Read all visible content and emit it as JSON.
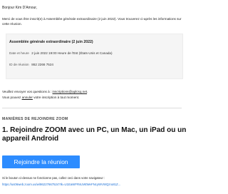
{
  "email": {
    "greeting": "Bonjour Kim D'Amour,",
    "intro": "Merci de vous être inscrit(e) à Assemblée générale extraordinaire (2 juin 2022). Vous trouverez ci-après les informations sur cette réunion.",
    "meeting": {
      "title": "Assemblée générale extraordinaire (2 juin 2022)",
      "date_label": "Date et heure",
      "date_value": "2 juin 2022 19:00 Heure de l'Est (États-Unis et Canada)",
      "id_label": "ID de réunion",
      "id_value": "862 2266 7524"
    },
    "contact_prefix": "Veuillez envoyer vos questions à : ",
    "contact_email": "inscriptions@aplcsq.net",
    "contact_suffix": ".",
    "cancel_prefix": "Vous pouvez ",
    "cancel_link": "annuler",
    "cancel_suffix": " votre inscription à tout moment.",
    "methods_heading": "MANIÈRES DE REJOINDRE ZOOM",
    "join_heading": "1. Rejoindre ZOOM avec un PC, un Mac, un iPad ou un appareil Android",
    "join_button": "Rejoindre la réunion",
    "fallback_text": "Si le bouton ci-dessus ne fonctionne pas, collez ceci dans votre navigateur :",
    "join_url": "https://us06web.zoom.us/w/86227667524?tk=U1EaWFRsUWtWeFNcyWVWQzru81Z..."
  }
}
